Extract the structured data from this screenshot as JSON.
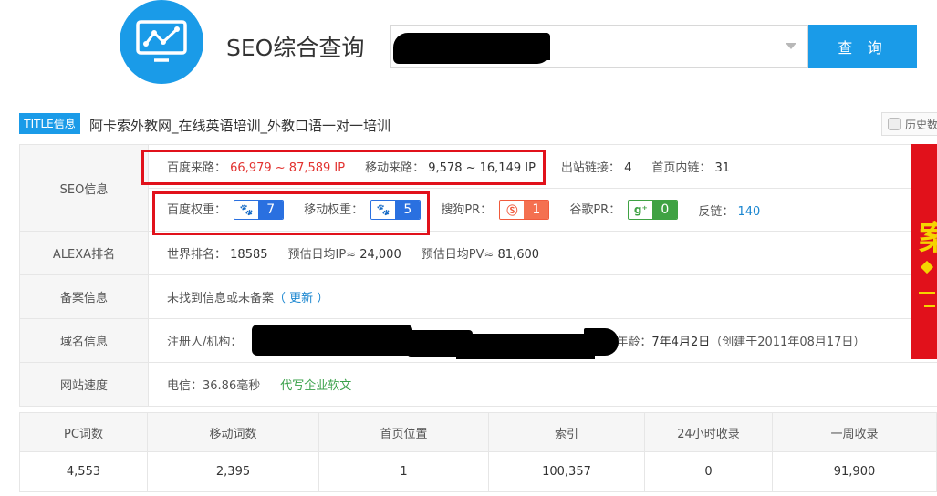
{
  "header": {
    "app_title": "SEO综合查询",
    "search_button": "查 询",
    "logo_icon": "chart-monitor-icon"
  },
  "title_row": {
    "badge": "TITLE信息",
    "title": "阿卡索外教网_在线英语培训_外教口语一对一培训",
    "history_label": "历史数"
  },
  "seo": {
    "label": "SEO信息",
    "baidu_traffic_label": "百度来路：",
    "baidu_traffic_value": "66,979 ~ 87,589 IP",
    "mobile_traffic_label": "移动来路：",
    "mobile_traffic_value": "9,578 ~ 16,149 IP",
    "outbound_label": "出站链接：",
    "outbound_value": "4",
    "inner_label": "首页内链：",
    "inner_value": "31",
    "baidu_weight_label": "百度权重：",
    "baidu_weight_value": "7",
    "mobile_weight_label": "移动权重：",
    "mobile_weight_value": "5",
    "sogou_pr_label": "搜狗PR：",
    "sogou_pr_value": "1",
    "google_pr_label": "谷歌PR：",
    "google_pr_value": "0",
    "backlinks_label": "反链：",
    "backlinks_value": "140"
  },
  "alexa": {
    "label": "ALEXA排名",
    "world_rank_label": "世界排名：",
    "world_rank_value": "18585",
    "daily_ip_label": "预估日均IP≈",
    "daily_ip_value": "24,000",
    "daily_pv_label": "预估日均PV≈",
    "daily_pv_value": "81,600"
  },
  "beian": {
    "label": "备案信息",
    "text": "未找到信息或未备案",
    "update_link": "（ 更新 ）"
  },
  "domain": {
    "label": "域名信息",
    "registrant_label": "注册人/机构：",
    "age_label": "年龄：",
    "age_value": "7年4月2日",
    "created": "（创建于2011年08月17日）"
  },
  "speed": {
    "label": "网站速度",
    "telecom": "电信：36.86毫秒",
    "ad_link": "代写企业软文"
  },
  "side_banner": {
    "glyph": "案"
  },
  "stats": {
    "headers": [
      "PC词数",
      "移动词数",
      "首页位置",
      "索引",
      "24小时收录",
      "一周收录"
    ],
    "values": [
      "4,553",
      "2,395",
      "1",
      "100,357",
      "0",
      "91,900"
    ]
  },
  "colors": {
    "accent": "#1a9be8",
    "highlight": "#e1111b",
    "traffic_red": "#e2322f",
    "link_blue": "#1a86d0",
    "green": "#3aa14a"
  }
}
